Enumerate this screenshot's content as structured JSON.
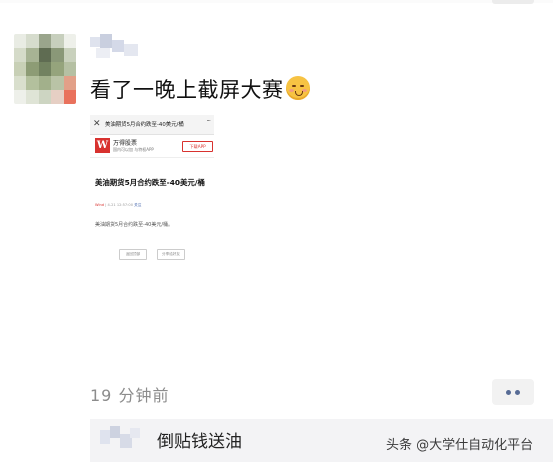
{
  "post": {
    "text": "看了一晚上截屏大赛",
    "emoji": "smiling-blush-emoji",
    "time": "19 分钟前"
  },
  "screenshot": {
    "close_glyph": "✕",
    "title": "美油期货5月合约跌至-40美元/桶",
    "more_glyph": "···",
    "app_logo": "W",
    "app_name": "万得股票",
    "app_sub": "国内可以加 与特权APP",
    "download": "下载APP",
    "headline": "美油期货5月合约跌至-40美元/桶",
    "meta_source": "Wind",
    "meta_mid": "| 4-21 12:57:00",
    "meta_follow": "关注",
    "body": "美油期货5月合约跌至-40美元/桶。",
    "button_left": "返回顶部",
    "button_right": "分享给好友"
  },
  "comments": [
    {
      "text": "倒贴钱送油"
    }
  ],
  "watermark": "头条 @大学仕自动化平台",
  "colors": {
    "link_blue": "#576b95",
    "wind_red": "#d8322f",
    "comment_bg": "#f3f3f5"
  }
}
